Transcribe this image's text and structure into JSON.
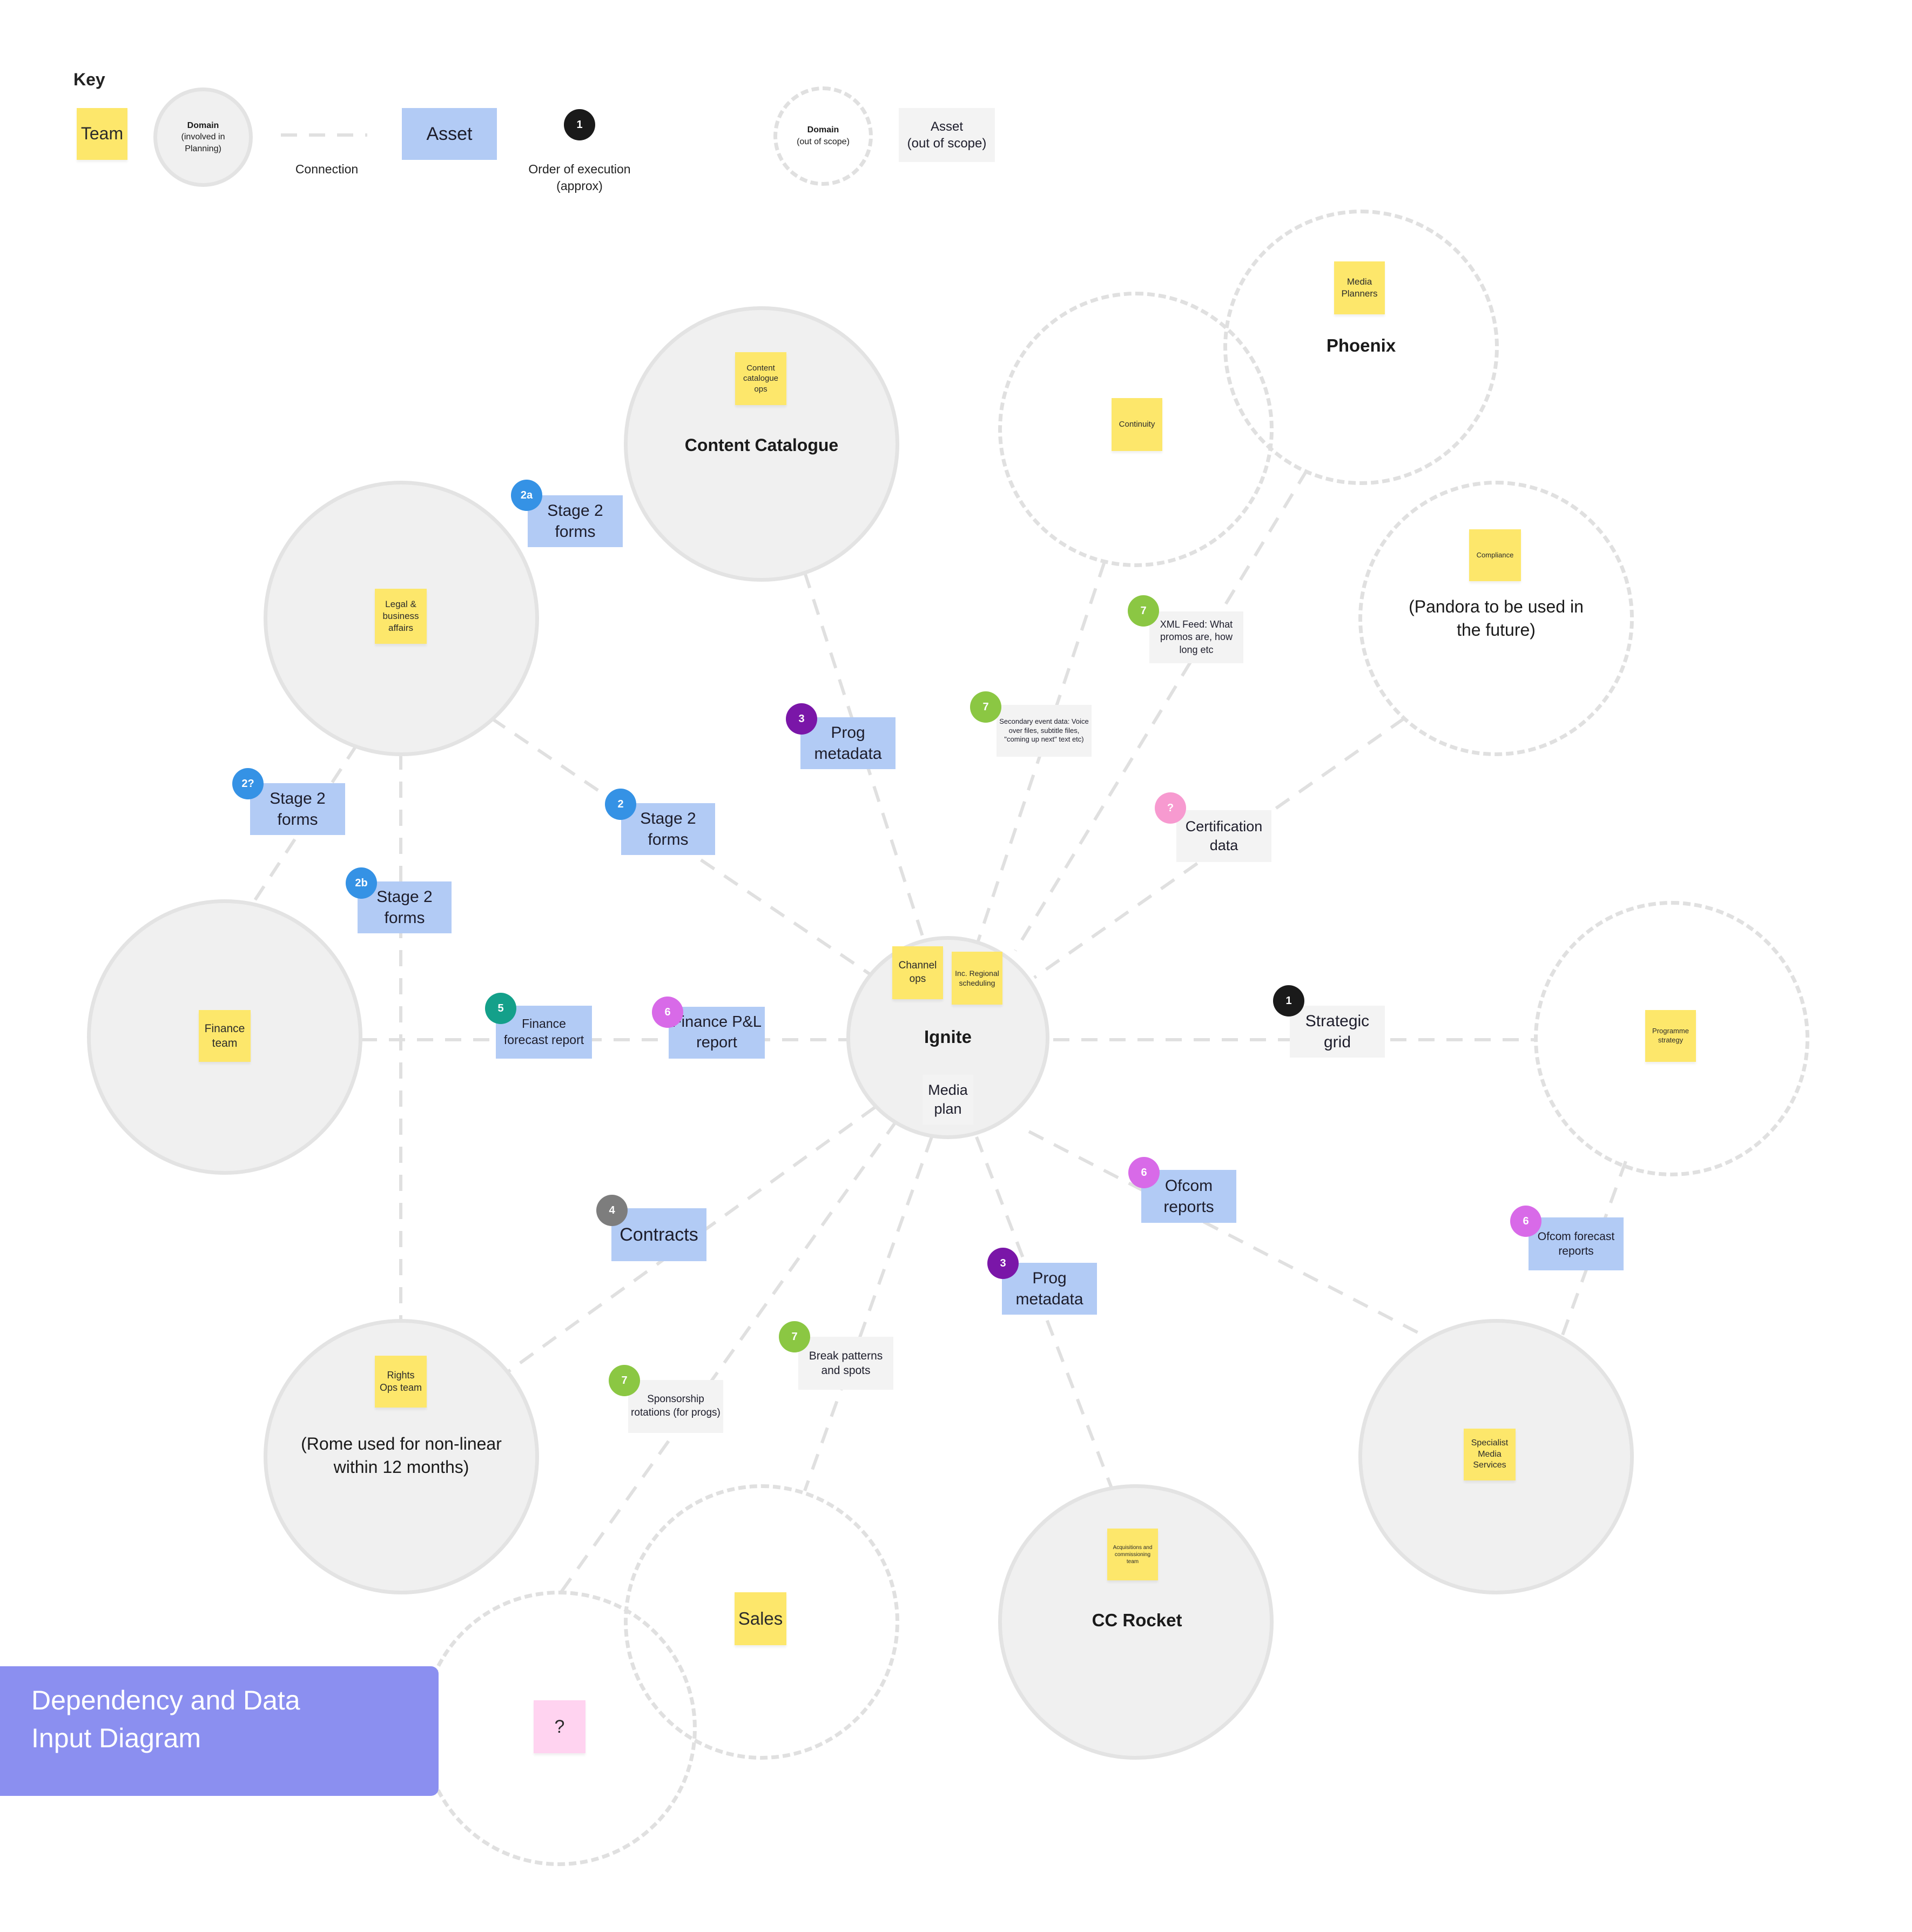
{
  "title": {
    "line1": "Dependency and Data",
    "line2": "Input Diagram"
  },
  "key": {
    "heading": "Key",
    "team": "Team",
    "domain_in_scope": {
      "name": "Domain",
      "note": "(involved in Planning)"
    },
    "connection": "Connection",
    "asset": "Asset",
    "order_badge": "1",
    "order_label": "Order of execution (approx)",
    "domain_out_of_scope": {
      "name": "Domain",
      "note": "(out of scope)"
    },
    "asset_out_of_scope": {
      "name": "Asset",
      "note": "(out of scope)"
    }
  },
  "domains": {
    "content_catalogue": {
      "label": "Content Catalogue",
      "team": "Content catalogue ops"
    },
    "legal": {
      "team": "Legal & business affairs"
    },
    "finance": {
      "team": "Finance team"
    },
    "rights": {
      "team": "Rights Ops team",
      "label": "(Rome used for non-linear within 12 months)"
    },
    "ignite": {
      "label": "Ignite",
      "team1": "Channel ops",
      "team2": "Inc. Regional scheduling",
      "asset": "Media plan"
    },
    "continuity": {
      "team": "Continuity"
    },
    "phoenix": {
      "label": "Phoenix",
      "team": "Media Planners"
    },
    "pandora": {
      "label": "(Pandora to be used in the future)",
      "team": "Compliance"
    },
    "programme_strategy": {
      "team": "Programme strategy"
    },
    "specialist": {
      "team": "Specialist Media Services"
    },
    "cc_rocket": {
      "label": "CC Rocket",
      "team": "Acquisitions and commissioning team"
    },
    "sales": {
      "team": "Sales"
    },
    "unknown": {
      "team": "?"
    }
  },
  "assets": {
    "stage2_2a": {
      "badge": "2a",
      "label": "Stage 2 forms"
    },
    "stage2_2q": {
      "badge": "2?",
      "label": "Stage 2 forms"
    },
    "stage2_2b": {
      "badge": "2b",
      "label": "Stage 2 forms"
    },
    "stage2_2": {
      "badge": "2",
      "label": "Stage 2 forms"
    },
    "prog_meta_top": {
      "badge": "3",
      "label": "Prog metadata"
    },
    "prog_meta_bottom": {
      "badge": "3",
      "label": "Prog metadata"
    },
    "contracts": {
      "badge": "4",
      "label": "Contracts"
    },
    "finance_forecast": {
      "badge": "5",
      "label": "Finance forecast report"
    },
    "finance_pl": {
      "badge": "6",
      "label": "Finance P&L report"
    },
    "ofcom_reports": {
      "badge": "6",
      "label": "Ofcom reports"
    },
    "ofcom_forecast": {
      "badge": "6",
      "label": "Ofcom forecast reports"
    },
    "xml_feed": {
      "badge": "7",
      "label": "XML Feed: What promos are, how long etc"
    },
    "secondary_event": {
      "badge": "7",
      "label": "Secondary event data: Voice over files, subtitle files, \"coming up next\" text etc)"
    },
    "certification": {
      "badge": "?",
      "label": "Certification data"
    },
    "strategic_grid": {
      "badge": "1",
      "label": "Strategic grid"
    },
    "break_patterns": {
      "badge": "7",
      "label": "Break patterns and spots"
    },
    "sponsorship": {
      "badge": "7",
      "label": "Sponsorship rotations (for progs)"
    }
  },
  "colors": {
    "team_sticky": "#fde76b",
    "asset": "#b2cbf5",
    "asset_out_of_scope": "#f3f3f3",
    "domain_fill": "#f0f0f0",
    "connection": "#e0e0e0",
    "title_panel": "#8b8ff0",
    "badge_black": "#1a1a1a",
    "badge_blue": "#3592e5",
    "badge_purple": "#7a16a8",
    "badge_grey": "#7d7d7d",
    "badge_teal": "#14a08a",
    "badge_violet": "#d86ae8",
    "badge_green": "#8bc743",
    "badge_pink": "#f79ad0"
  }
}
